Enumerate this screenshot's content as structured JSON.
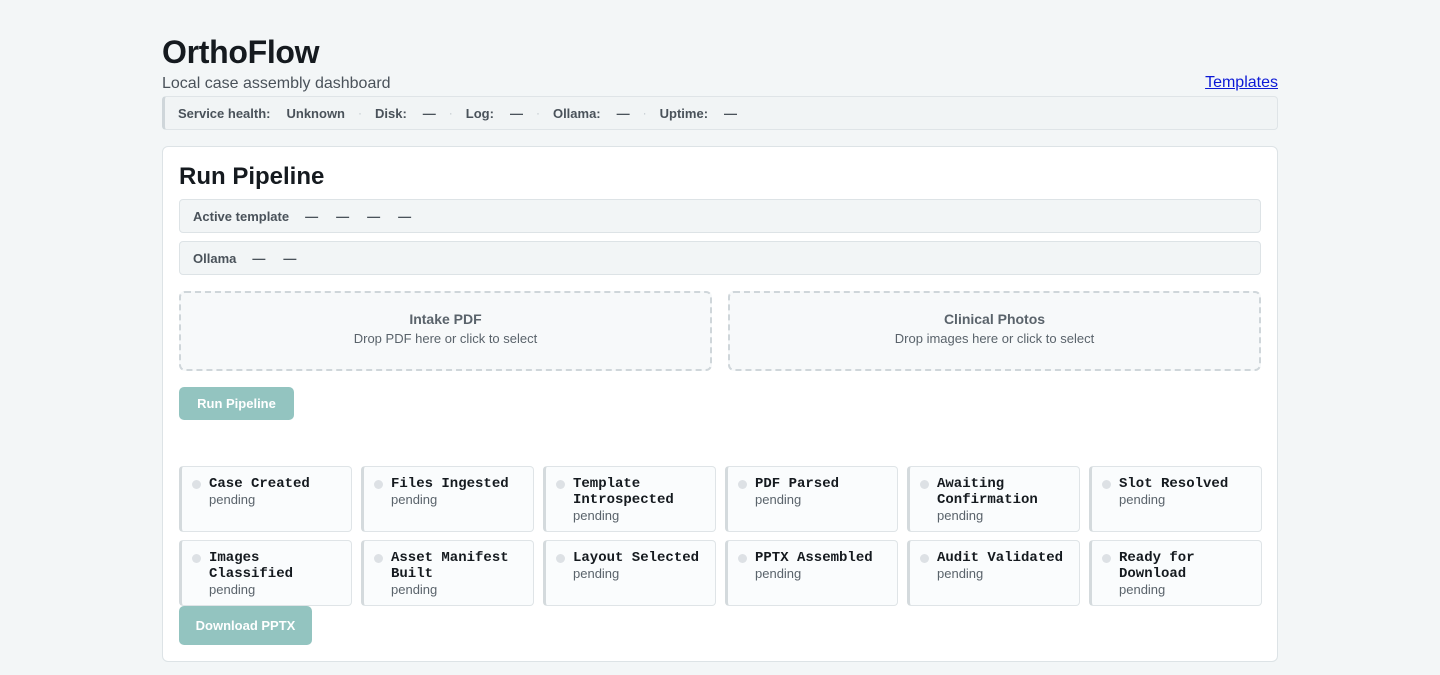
{
  "header": {
    "title": "OrthoFlow",
    "subtitle": "Local case assembly dashboard",
    "templates_link": "Templates"
  },
  "health": [
    {
      "label": "Service health:",
      "value": "Unknown"
    },
    {
      "label": "Disk:",
      "value": "—"
    },
    {
      "label": "Log:",
      "value": "—"
    },
    {
      "label": "Ollama:",
      "value": "—"
    },
    {
      "label": "Uptime:",
      "value": "—"
    }
  ],
  "separator": "·",
  "pipeline": {
    "title": "Run Pipeline",
    "active_template": {
      "label": "Active template",
      "values": [
        "—",
        "—",
        "—",
        "—"
      ]
    },
    "ollama": {
      "label": "Ollama",
      "values": [
        "—",
        "—"
      ]
    },
    "dropzones": {
      "pdf": {
        "title": "Intake PDF",
        "hint": "Drop PDF here or click to select"
      },
      "photos": {
        "title": "Clinical Photos",
        "hint": "Drop images here or click to select"
      }
    },
    "run_button": "Run Pipeline",
    "download_button": "Download PPTX"
  },
  "steps": [
    {
      "name": "Case Created",
      "status": "pending"
    },
    {
      "name": "Files Ingested",
      "status": "pending"
    },
    {
      "name": "Template Introspected",
      "status": "pending"
    },
    {
      "name": "PDF Parsed",
      "status": "pending"
    },
    {
      "name": "Awaiting Confirmation",
      "status": "pending"
    },
    {
      "name": "Slot Resolved",
      "status": "pending"
    },
    {
      "name": "Images Classified",
      "status": "pending"
    },
    {
      "name": "Asset Manifest Built",
      "status": "pending"
    },
    {
      "name": "Layout Selected",
      "status": "pending"
    },
    {
      "name": "PPTX Assembled",
      "status": "pending"
    },
    {
      "name": "Audit Validated",
      "status": "pending"
    },
    {
      "name": "Ready for Download",
      "status": "pending"
    }
  ],
  "colors": {
    "accent_button": "#93c4c0",
    "link": "#0b18d6",
    "pending_dot": "#dde1e5"
  }
}
